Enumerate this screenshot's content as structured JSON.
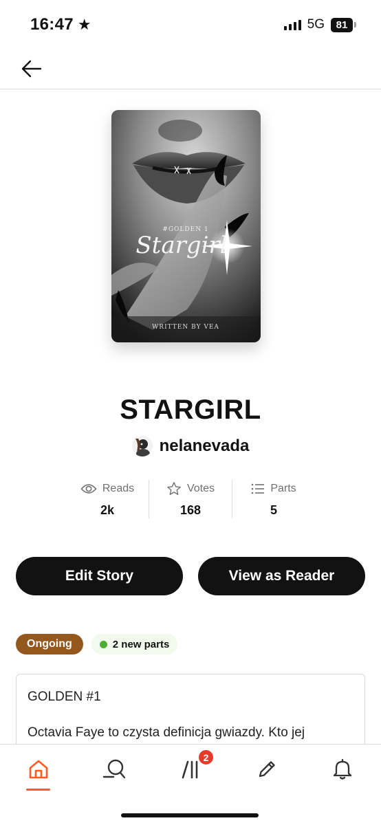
{
  "status_bar": {
    "time": "16:47",
    "network": "5G",
    "battery": "81"
  },
  "cover": {
    "series_line": "#GOLDEN 1",
    "title": "Stargirl",
    "byline": "WRITTEN BY VEA"
  },
  "story": {
    "title": "STARGIRL",
    "author": "nelanevada"
  },
  "stats": [
    {
      "label": "Reads",
      "value": "2k",
      "icon": "eye-icon"
    },
    {
      "label": "Votes",
      "value": "168",
      "icon": "star-icon"
    },
    {
      "label": "Parts",
      "value": "5",
      "icon": "list-icon"
    }
  ],
  "actions": {
    "edit": "Edit Story",
    "view": "View as Reader"
  },
  "tags": {
    "status": "Ongoing",
    "new_parts": "2 new parts"
  },
  "description": {
    "heading": "GOLDEN #1",
    "text": "Octavia Faye to czysta definicja gwiazdy. Kto jej"
  },
  "nav": {
    "library_badge": "2",
    "active": "home"
  },
  "colors": {
    "accent": "#ff5a1f",
    "ongoing": "#94581d",
    "new_dot": "#4fae33",
    "badge": "#e8392a"
  }
}
